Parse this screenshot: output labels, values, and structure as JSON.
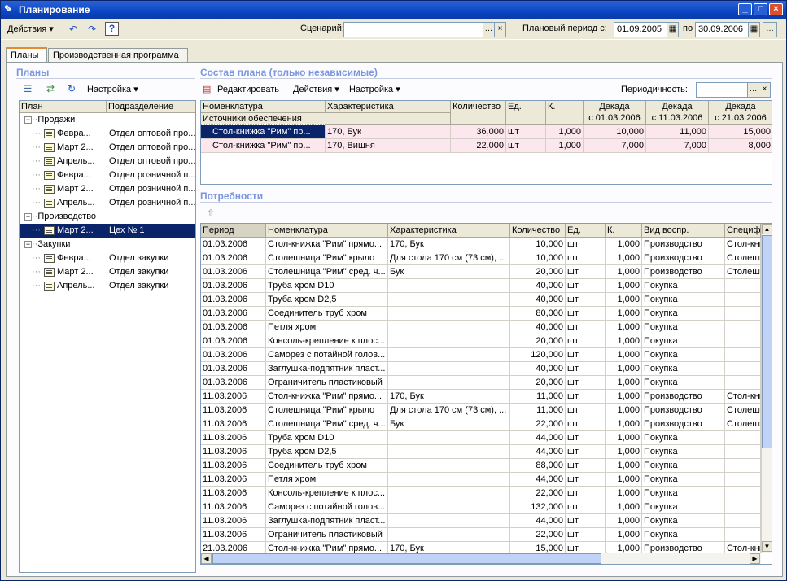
{
  "window": {
    "title": "Планирование"
  },
  "toolbar": {
    "actions_label": "Действия",
    "help_label": "?",
    "scenario_label": "Сценарий:",
    "scenario_value": "",
    "period_label": "Плановый период с:",
    "period_from": "01.09.2005",
    "period_to_label": "по",
    "period_to": "30.09.2006"
  },
  "tabs": [
    {
      "label": "Планы"
    },
    {
      "label": "Производственная программа"
    }
  ],
  "plans": {
    "title": "Планы",
    "settings_label": "Настройка",
    "columns": [
      "План",
      "Подразделение"
    ],
    "tree": [
      {
        "type": "group",
        "label": "Продажи"
      },
      {
        "type": "item",
        "plan": "Февра...",
        "dept": "Отдел оптовой про..."
      },
      {
        "type": "item",
        "plan": "Март 2...",
        "dept": "Отдел оптовой про..."
      },
      {
        "type": "item",
        "plan": "Апрель...",
        "dept": "Отдел оптовой про..."
      },
      {
        "type": "item",
        "plan": "Февра...",
        "dept": "Отдел розничной п..."
      },
      {
        "type": "item",
        "plan": "Март 2...",
        "dept": "Отдел розничной п..."
      },
      {
        "type": "item",
        "plan": "Апрель...",
        "dept": "Отдел розничной п..."
      },
      {
        "type": "group",
        "label": "Производство"
      },
      {
        "type": "item",
        "plan": "Март 2...",
        "dept": "Цех № 1",
        "selected": true
      },
      {
        "type": "group",
        "label": "Закупки"
      },
      {
        "type": "item",
        "plan": "Февра...",
        "dept": "Отдел закупки"
      },
      {
        "type": "item",
        "plan": "Март 2...",
        "dept": "Отдел закупки"
      },
      {
        "type": "item",
        "plan": "Апрель...",
        "dept": "Отдел закупки"
      }
    ]
  },
  "composition": {
    "title": "Состав плана (только независимые)",
    "edit_label": "Редактировать",
    "actions_label": "Действия",
    "settings_label": "Настройка",
    "periodicity_label": "Периодичность:",
    "periodicity_value": "",
    "headers": {
      "nomenclature": "Номенклатура",
      "sources": "Источники обеспечения",
      "characteristic": "Характеристика",
      "quantity": "Количество",
      "unit": "Ед.",
      "k": "К.",
      "d1a": "Декада",
      "d1b": "с 01.03.2006",
      "d2a": "Декада",
      "d2b": "с 11.03.2006",
      "d3a": "Декада",
      "d3b": "с 21.03.2006"
    },
    "rows": [
      {
        "nom": "Стол-книжка \"Рим\" пр...",
        "char": "170, Бук",
        "qty": "36,000",
        "unit": "шт",
        "k": "1,000",
        "d1": "10,000",
        "d2": "11,000",
        "d3": "15,000"
      },
      {
        "nom": "Стол-книжка \"Рим\" пр...",
        "char": "170, Вишня",
        "qty": "22,000",
        "unit": "шт",
        "k": "1,000",
        "d1": "7,000",
        "d2": "7,000",
        "d3": "8,000"
      }
    ]
  },
  "needs": {
    "title": "Потребности",
    "headers": [
      "Период",
      "Номенклатура",
      "Характеристика",
      "Количество",
      "Ед.",
      "К.",
      "Вид воспр.",
      "Специф"
    ],
    "rows": [
      [
        "01.03.2006",
        "Стол-книжка \"Рим\" прямо...",
        "170, Бук",
        "10,000",
        "шт",
        "1,000",
        "Производство",
        "Стол-кни"
      ],
      [
        "01.03.2006",
        "Столешница \"Рим\" крыло",
        "Для стола 170 см (73 см), ...",
        "10,000",
        "шт",
        "1,000",
        "Производство",
        "Столешн"
      ],
      [
        "01.03.2006",
        "Столешница \"Рим\" сред. ч...",
        "Бук",
        "20,000",
        "шт",
        "1,000",
        "Производство",
        "Столешн"
      ],
      [
        "01.03.2006",
        "Труба хром D10",
        "",
        "40,000",
        "шт",
        "1,000",
        "Покупка",
        ""
      ],
      [
        "01.03.2006",
        "Труба хром D2,5",
        "",
        "40,000",
        "шт",
        "1,000",
        "Покупка",
        ""
      ],
      [
        "01.03.2006",
        "Соединитель труб хром",
        "",
        "80,000",
        "шт",
        "1,000",
        "Покупка",
        ""
      ],
      [
        "01.03.2006",
        "Петля хром",
        "",
        "40,000",
        "шт",
        "1,000",
        "Покупка",
        ""
      ],
      [
        "01.03.2006",
        "Консоль-крепление к плос...",
        "",
        "20,000",
        "шт",
        "1,000",
        "Покупка",
        ""
      ],
      [
        "01.03.2006",
        "Саморез с потайной голов...",
        "",
        "120,000",
        "шт",
        "1,000",
        "Покупка",
        ""
      ],
      [
        "01.03.2006",
        "Заглушка-подпятник пласт...",
        "",
        "40,000",
        "шт",
        "1,000",
        "Покупка",
        ""
      ],
      [
        "01.03.2006",
        "Ограничитель пластиковый",
        "",
        "20,000",
        "шт",
        "1,000",
        "Покупка",
        ""
      ],
      [
        "11.03.2006",
        "Стол-книжка \"Рим\" прямо...",
        "170, Бук",
        "11,000",
        "шт",
        "1,000",
        "Производство",
        "Стол-кни"
      ],
      [
        "11.03.2006",
        "Столешница \"Рим\" крыло",
        "Для стола 170 см (73 см), ...",
        "11,000",
        "шт",
        "1,000",
        "Производство",
        "Столешн"
      ],
      [
        "11.03.2006",
        "Столешница \"Рим\" сред. ч...",
        "Бук",
        "22,000",
        "шт",
        "1,000",
        "Производство",
        "Столешн"
      ],
      [
        "11.03.2006",
        "Труба хром D10",
        "",
        "44,000",
        "шт",
        "1,000",
        "Покупка",
        ""
      ],
      [
        "11.03.2006",
        "Труба хром D2,5",
        "",
        "44,000",
        "шт",
        "1,000",
        "Покупка",
        ""
      ],
      [
        "11.03.2006",
        "Соединитель труб хром",
        "",
        "88,000",
        "шт",
        "1,000",
        "Покупка",
        ""
      ],
      [
        "11.03.2006",
        "Петля хром",
        "",
        "44,000",
        "шт",
        "1,000",
        "Покупка",
        ""
      ],
      [
        "11.03.2006",
        "Консоль-крепление к плос...",
        "",
        "22,000",
        "шт",
        "1,000",
        "Покупка",
        ""
      ],
      [
        "11.03.2006",
        "Саморез с потайной голов...",
        "",
        "132,000",
        "шт",
        "1,000",
        "Покупка",
        ""
      ],
      [
        "11.03.2006",
        "Заглушка-подпятник пласт...",
        "",
        "44,000",
        "шт",
        "1,000",
        "Покупка",
        ""
      ],
      [
        "11.03.2006",
        "Ограничитель пластиковый",
        "",
        "22,000",
        "шт",
        "1,000",
        "Покупка",
        ""
      ],
      [
        "21.03.2006",
        "Стол-книжка \"Рим\" прямо...",
        "170, Бук",
        "15,000",
        "шт",
        "1,000",
        "Производство",
        "Стол-кни"
      ]
    ]
  }
}
